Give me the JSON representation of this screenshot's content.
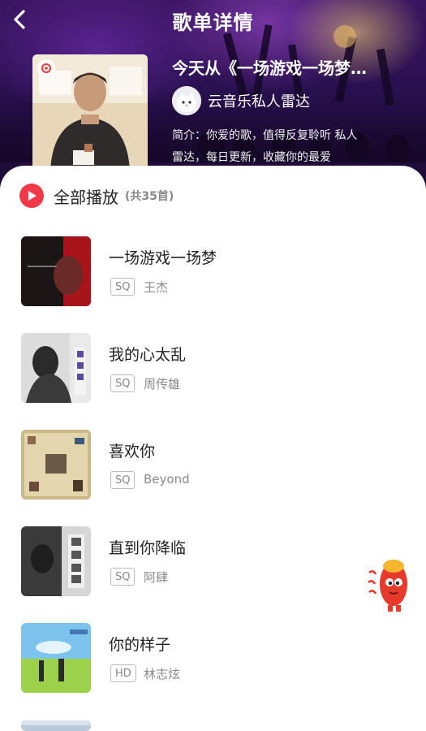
{
  "header": {
    "title": "歌单详情",
    "back_icon": "chevron-left-icon"
  },
  "playlist": {
    "name": "今天从《一场游戏一场梦…",
    "creator": "云音乐私人雷达",
    "intro_line1": "简介：你爱的歌，值得反复聆听 私人",
    "intro_line2": "雷达，每日更新，收藏你的最爱"
  },
  "play_all": {
    "label": "全部播放",
    "count_prefix": "(共",
    "count": "35",
    "count_suffix": "首)"
  },
  "songs": [
    {
      "title": "一场游戏一场梦",
      "quality": "SQ",
      "artist": "王杰"
    },
    {
      "title": "我的心太乱",
      "quality": "SQ",
      "artist": "周传雄"
    },
    {
      "title": "喜欢你",
      "quality": "SQ",
      "artist": "Beyond"
    },
    {
      "title": "直到你降临",
      "quality": "SQ",
      "artist": "阿肆"
    },
    {
      "title": "你的样子",
      "quality": "HD",
      "artist": "林志炫"
    }
  ],
  "colors": {
    "accent": "#f2394a",
    "header_bg": "#2a1050"
  }
}
